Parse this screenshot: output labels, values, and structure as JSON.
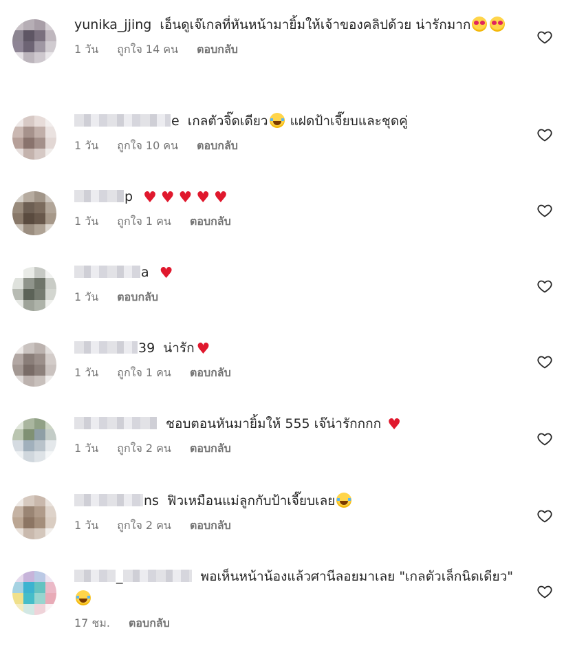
{
  "comments": [
    {
      "user_visible": "yunika_jjing",
      "text": "เอ็นดูเจ๊เกลที่หันหน้ามายิ้มให้เจ้าของคลิปด้วย น่ารักมาก",
      "emojis": [
        "smiling-face-with-heart-eyes",
        "smiling-face-with-heart-eyes"
      ],
      "time": "1 วัน",
      "likes": "ถูกใจ 14 คน",
      "reply": "ตอบกลับ",
      "avatar_colors": [
        "#c9c1c7",
        "#b7aeb6",
        "#a99da8",
        "#d6cfd4",
        "#8d8593",
        "#5f5566",
        "#7b6f80",
        "#c0b7bf",
        "#8f8497",
        "#6e6376",
        "#a097a5",
        "#d1cbd1",
        "#e4dfe3",
        "#bdb5bd",
        "#cfc8cf",
        "#eae7ea"
      ]
    },
    {
      "user_visible": "e",
      "text": "เกลตัวจิ๊ดเดียว",
      "text2": "แฝดป้าเจี๊ยบและชุดคู่",
      "emojis": [
        "face-with-tears-of-joy"
      ],
      "time": "1 วัน",
      "likes": "ถูกใจ 10 คน",
      "reply": "ตอบกลับ",
      "avatar_colors": [
        "#efe8e6",
        "#d9c9c4",
        "#e8dcd8",
        "#f3eeed",
        "#cdb7b0",
        "#a9918a",
        "#c4aea7",
        "#ebe2df",
        "#b99f97",
        "#8c726b",
        "#a78f88",
        "#e3d7d3",
        "#e7dedb",
        "#c6b2ab",
        "#d8c9c4",
        "#f1ecea"
      ]
    },
    {
      "user_visible": "p",
      "text": "",
      "hearts": 5,
      "time": "1 วัน",
      "likes": "ถูกใจ 1 คน",
      "reply": "ตอบกลับ",
      "avatar_colors": [
        "#d7d1c9",
        "#b8ab9c",
        "#a39585",
        "#cfc7bd",
        "#9a8a78",
        "#6f5f50",
        "#7d6b5a",
        "#b3a595",
        "#8a7866",
        "#5c4b3d",
        "#6a5848",
        "#a89886",
        "#cbc2b6",
        "#9d8e7d",
        "#b1a392",
        "#ddd6cd"
      ]
    },
    {
      "user_visible": "a",
      "text": "",
      "hearts": 1,
      "time": "1 วัน",
      "likes": "",
      "reply": "ตอบกลับ",
      "avatar_colors": [
        "#ffffff",
        "#e9ebe7",
        "#c6c9c3",
        "#f2f3f1",
        "#dfe2dc",
        "#8e948a",
        "#6e7568",
        "#c9ccc5",
        "#b7bbb2",
        "#5b6356",
        "#747b6e",
        "#d3d6cf",
        "#e6e8e3",
        "#9da398",
        "#aeb3a8",
        "#eff0ed"
      ]
    },
    {
      "user_visible": "39",
      "text": "น่ารัก",
      "hearts": 1,
      "time": "1 วัน",
      "likes": "ถูกใจ 1 คน",
      "reply": "ตอบกลับ",
      "avatar_colors": [
        "#ece8e6",
        "#cbc3bf",
        "#bcb2ad",
        "#e3dedb",
        "#b3a7a2",
        "#8c7e78",
        "#9d8f89",
        "#d4ccc8",
        "#a59892",
        "#7b6c66",
        "#8e807a",
        "#cbc2be",
        "#dfd9d6",
        "#bdb2ad",
        "#c9c0bb",
        "#eeebea"
      ]
    },
    {
      "user_visible": "",
      "text": "ชอบตอนหันมายิ้มให้ 555 เจ๊น่ารักกกก",
      "hearts": 1,
      "time": "1 วัน",
      "likes": "ถูกใจ 2 คน",
      "reply": "ตอบกลับ",
      "avatar_colors": [
        "#dfe6d9",
        "#a9b79c",
        "#8fa282",
        "#cbd6c1",
        "#b9c6ad",
        "#7e9270",
        "#8d9fa8",
        "#c2ccc6",
        "#d4dbe2",
        "#9fb0be",
        "#b7c3cd",
        "#e3e8ec",
        "#eef1f3",
        "#cfd7de",
        "#dde3e8",
        "#f5f7f8"
      ]
    },
    {
      "user_visible": "ns",
      "text": "ฟิวเหมือนแม่ลูกกับป้าเจี๊ยบเลย",
      "emojis": [
        "face-with-tears-of-joy"
      ],
      "time": "1 วัน",
      "likes": "ถูกใจ 2 คน",
      "reply": "ตอบกลับ",
      "avatar_colors": [
        "#efe9e4",
        "#d8c9bd",
        "#cbb8a9",
        "#eae2db",
        "#c8b3a1",
        "#9d8470",
        "#b39a86",
        "#e0d3c8",
        "#bea58f",
        "#8f745f",
        "#a78d77",
        "#dccdc0",
        "#e9e0d8",
        "#cbb9aa",
        "#d6c7ba",
        "#f3efeb"
      ]
    },
    {
      "user_visible": "_",
      "text": "พอเห็นหน้าน้องแล้วศานีลอยมาเลย \"เกลตัวเล็กนิดเดียว\"",
      "emojis": [
        "face-with-tears-of-joy"
      ],
      "time": "17 ชม.",
      "likes": "",
      "reply": "ตอบกลับ",
      "avatar_colors": [
        "#e7d9ef",
        "#c9b3e0",
        "#b9c9ea",
        "#efe6f5",
        "#9fd3e6",
        "#2bb7d9",
        "#58c7c4",
        "#f2b7c7",
        "#f3e07c",
        "#34c1cf",
        "#8fd7d0",
        "#f0a9b7",
        "#f6ebb6",
        "#cfe9e4",
        "#f3d2d9",
        "#fbf3f5"
      ]
    }
  ],
  "icons": {
    "like": "heart-outline-icon"
  }
}
